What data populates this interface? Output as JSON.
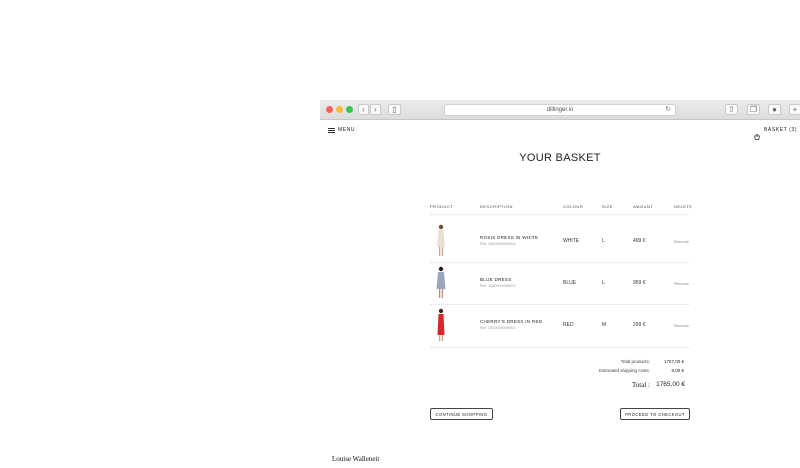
{
  "browser": {
    "url": "dillinger.io"
  },
  "site": {
    "menu_label": "MENU",
    "basket_label": "BASKET (3)",
    "page_title": "YOUR BASKET"
  },
  "table": {
    "headers": [
      "PRODUCT",
      "DESCRIPTION",
      "COLOUR",
      "SIZE",
      "AMOUNT",
      "DELETE"
    ],
    "rows": [
      {
        "name": "ROSIS DRESS IN WHITE",
        "ref": "Ref. 1000000000001",
        "colour": "WHITE",
        "size": "L",
        "amount": "499 €",
        "delete": "Remove",
        "dress_color": "#e8ded2"
      },
      {
        "name": "BLUE DRESS",
        "ref": "Ref. 1000000000001",
        "colour": "BLUE",
        "size": "L",
        "amount": "959 €",
        "delete": "Remove",
        "dress_color": "#9aa7b8"
      },
      {
        "name": "CHERRY'S DRESS IN RED",
        "ref": "Ref. 1000000000001",
        "colour": "RED",
        "size": "M",
        "amount": "299 €",
        "delete": "Remove",
        "dress_color": "#d8262b"
      }
    ]
  },
  "summary": {
    "total_products_label": "Total products:",
    "total_products_value": "1757,00 €",
    "shipping_label": "Estimated shipping costs:",
    "shipping_value": "8,00 €",
    "total_label": "Total :",
    "total_value": "1765,00 €"
  },
  "actions": {
    "continue_label": "CONTINUE SHOPPING",
    "checkout_label": "PROCEED TO CHECKOUT"
  },
  "footer": {
    "signature": "Louise Walleneit"
  }
}
